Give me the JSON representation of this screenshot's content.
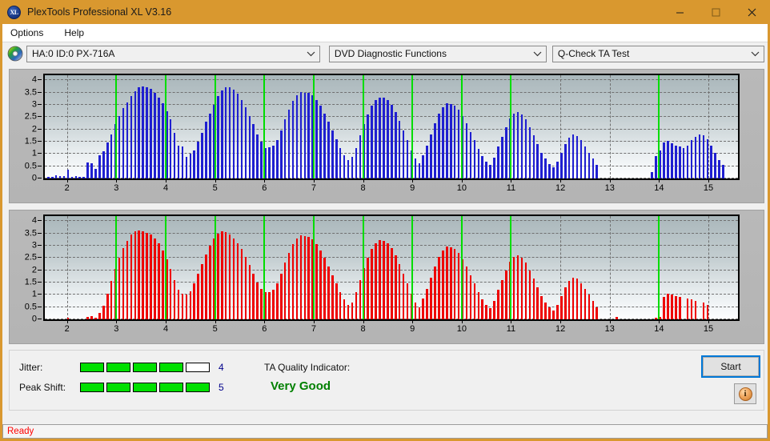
{
  "window": {
    "title": "PlexTools Professional XL V3.16",
    "icon": "XL",
    "controls": {
      "minimize": "minimize-icon",
      "maximize": "maximize-icon",
      "close": "close-icon"
    }
  },
  "menu": {
    "items": [
      "Options",
      "Help"
    ]
  },
  "toolbar": {
    "drive_icon": "disc-icon",
    "drive_select": {
      "value": "HA:0 ID:0  PX-716A"
    },
    "function_select": {
      "value": "DVD Diagnostic Functions"
    },
    "test_select": {
      "value": "Q-Check TA Test"
    }
  },
  "status": {
    "text": "Ready"
  },
  "results": {
    "jitter_label": "Jitter:",
    "jitter_value": "4",
    "jitter_filled": 4,
    "jitter_total": 5,
    "peak_shift_label": "Peak Shift:",
    "peak_shift_value": "5",
    "peak_shift_filled": 5,
    "peak_shift_total": 5,
    "tqi_label": "TA Quality Indicator:",
    "tqi_value": "Very Good",
    "tqi_color": "#008000",
    "start_button": "Start",
    "info_button": "i"
  },
  "chart_data": [
    {
      "id": "ta-test-jitter-chart",
      "type": "bar",
      "title": "",
      "xlabel": "",
      "ylabel": "",
      "series_color": "#1f1fd0",
      "marker_color": "#00dd00",
      "grid": true,
      "xlim": [
        1.55,
        15.6
      ],
      "ylim": [
        0,
        4.2
      ],
      "xticks": [
        2,
        3,
        4,
        5,
        6,
        7,
        8,
        9,
        10,
        11,
        12,
        13,
        14,
        15
      ],
      "yticks": [
        0,
        0.5,
        1,
        1.5,
        2,
        2.5,
        3,
        3.5,
        4
      ],
      "ytick_labels": [
        "0",
        "0.5",
        "1",
        "1.5",
        "2",
        "2.5",
        "3",
        "3.5",
        "4"
      ],
      "markers_x": [
        3,
        4,
        5,
        6,
        7,
        8,
        9,
        10,
        11,
        14
      ],
      "x": [
        1.62,
        1.7,
        1.78,
        1.86,
        1.94,
        2.02,
        2.1,
        2.18,
        2.26,
        2.34,
        2.42,
        2.5,
        2.58,
        2.66,
        2.74,
        2.82,
        2.9,
        2.98,
        3.06,
        3.14,
        3.22,
        3.3,
        3.38,
        3.46,
        3.54,
        3.62,
        3.7,
        3.78,
        3.86,
        3.94,
        4.02,
        4.1,
        4.18,
        4.26,
        4.34,
        4.42,
        4.5,
        4.58,
        4.66,
        4.74,
        4.82,
        4.9,
        4.98,
        5.06,
        5.14,
        5.22,
        5.3,
        5.38,
        5.46,
        5.54,
        5.62,
        5.7,
        5.78,
        5.86,
        5.94,
        6.02,
        6.1,
        6.18,
        6.26,
        6.34,
        6.42,
        6.5,
        6.58,
        6.66,
        6.74,
        6.82,
        6.9,
        6.98,
        7.06,
        7.14,
        7.22,
        7.3,
        7.38,
        7.46,
        7.54,
        7.62,
        7.7,
        7.78,
        7.86,
        7.94,
        8.02,
        8.1,
        8.18,
        8.26,
        8.34,
        8.42,
        8.5,
        8.58,
        8.66,
        8.74,
        8.82,
        8.9,
        8.98,
        9.06,
        9.14,
        9.22,
        9.3,
        9.38,
        9.46,
        9.54,
        9.62,
        9.7,
        9.78,
        9.86,
        9.94,
        10.02,
        10.1,
        10.18,
        10.26,
        10.34,
        10.42,
        10.5,
        10.58,
        10.66,
        10.74,
        10.82,
        10.9,
        10.98,
        11.06,
        11.14,
        11.22,
        11.3,
        11.38,
        11.46,
        11.54,
        11.62,
        11.7,
        11.78,
        11.86,
        11.94,
        12.02,
        12.1,
        12.18,
        12.26,
        12.34,
        12.42,
        12.5,
        12.58,
        12.66,
        12.74,
        12.82,
        12.9,
        12.98,
        13.06,
        13.14,
        13.22,
        13.3,
        13.38,
        13.46,
        13.54,
        13.62,
        13.7,
        13.78,
        13.86,
        13.94,
        14.02,
        14.1,
        14.18,
        14.26,
        14.34,
        14.42,
        14.5,
        14.58,
        14.66,
        14.74,
        14.82,
        14.9,
        14.98,
        15.06,
        15.14,
        15.22,
        15.3,
        15.38
      ],
      "values": [
        0.08,
        0.05,
        0.12,
        0.1,
        0.09,
        0.35,
        0.08,
        0.1,
        0.07,
        0.05,
        0.65,
        0.62,
        0.4,
        0.95,
        1.1,
        1.45,
        1.8,
        2.2,
        2.55,
        2.85,
        3.1,
        3.35,
        3.55,
        3.7,
        3.75,
        3.72,
        3.65,
        3.5,
        3.3,
        3.05,
        2.75,
        2.4,
        1.85,
        1.35,
        1.3,
        0.88,
        1.02,
        1.15,
        1.5,
        1.85,
        2.3,
        2.65,
        3.0,
        3.35,
        3.58,
        3.72,
        3.7,
        3.6,
        3.45,
        3.2,
        2.9,
        2.55,
        2.2,
        1.8,
        1.5,
        1.25,
        1.28,
        1.35,
        1.55,
        1.95,
        2.4,
        2.8,
        3.15,
        3.4,
        3.52,
        3.5,
        3.48,
        3.4,
        3.2,
        2.95,
        2.65,
        2.3,
        1.95,
        1.6,
        1.25,
        0.95,
        0.75,
        0.88,
        1.25,
        1.75,
        2.2,
        2.6,
        2.95,
        3.2,
        3.3,
        3.28,
        3.2,
        3.0,
        2.7,
        2.35,
        1.95,
        1.55,
        1.15,
        0.82,
        0.62,
        0.95,
        1.35,
        1.8,
        2.25,
        2.65,
        2.9,
        3.05,
        3.02,
        2.95,
        2.8,
        2.55,
        2.25,
        1.9,
        1.55,
        1.2,
        0.9,
        0.7,
        0.55,
        0.85,
        1.3,
        1.7,
        2.1,
        2.45,
        2.65,
        2.7,
        2.6,
        2.4,
        2.1,
        1.75,
        1.4,
        1.05,
        0.8,
        0.6,
        0.45,
        0.7,
        1.05,
        1.4,
        1.65,
        1.78,
        1.72,
        1.55,
        1.3,
        1.05,
        0.8,
        0.55,
        0.0,
        0.0,
        0.0,
        0.0,
        0.0,
        0.0,
        0.0,
        0.0,
        0.0,
        0.0,
        0.0,
        0.0,
        0.0,
        0.25,
        0.9,
        1.15,
        1.45,
        1.52,
        1.42,
        1.35,
        1.3,
        1.25,
        1.35,
        1.55,
        1.7,
        1.8,
        1.75,
        1.6,
        1.35,
        1.05,
        0.75,
        0.55,
        0.0,
        0.0,
        0.0,
        0.0,
        0.0,
        0.0
      ]
    },
    {
      "id": "ta-test-peak-shift-chart",
      "type": "bar",
      "title": "",
      "xlabel": "",
      "ylabel": "",
      "series_color": "#ee0000",
      "marker_color": "#00dd00",
      "grid": true,
      "xlim": [
        1.55,
        15.6
      ],
      "ylim": [
        0,
        4.2
      ],
      "xticks": [
        2,
        3,
        4,
        5,
        6,
        7,
        8,
        9,
        10,
        11,
        12,
        13,
        14,
        15
      ],
      "yticks": [
        0,
        0.5,
        1,
        1.5,
        2,
        2.5,
        3,
        3.5,
        4
      ],
      "ytick_labels": [
        "0",
        "0.5",
        "1",
        "1.5",
        "2",
        "2.5",
        "3",
        "3.5",
        "4"
      ],
      "markers_x": [
        3,
        4,
        5,
        6,
        7,
        8,
        9,
        10,
        11,
        14
      ],
      "x": [
        1.62,
        1.7,
        1.78,
        1.86,
        1.94,
        2.02,
        2.1,
        2.18,
        2.26,
        2.34,
        2.42,
        2.5,
        2.58,
        2.66,
        2.74,
        2.82,
        2.9,
        2.98,
        3.06,
        3.14,
        3.22,
        3.3,
        3.38,
        3.46,
        3.54,
        3.62,
        3.7,
        3.78,
        3.86,
        3.94,
        4.02,
        4.1,
        4.18,
        4.26,
        4.34,
        4.42,
        4.5,
        4.58,
        4.66,
        4.74,
        4.82,
        4.9,
        4.98,
        5.06,
        5.14,
        5.22,
        5.3,
        5.38,
        5.46,
        5.54,
        5.62,
        5.7,
        5.78,
        5.86,
        5.94,
        6.02,
        6.1,
        6.18,
        6.26,
        6.34,
        6.42,
        6.5,
        6.58,
        6.66,
        6.74,
        6.82,
        6.9,
        6.98,
        7.06,
        7.14,
        7.22,
        7.3,
        7.38,
        7.46,
        7.54,
        7.62,
        7.7,
        7.78,
        7.86,
        7.94,
        8.02,
        8.1,
        8.18,
        8.26,
        8.34,
        8.42,
        8.5,
        8.58,
        8.66,
        8.74,
        8.82,
        8.9,
        8.98,
        9.06,
        9.14,
        9.22,
        9.3,
        9.38,
        9.46,
        9.54,
        9.62,
        9.7,
        9.78,
        9.86,
        9.94,
        10.02,
        10.1,
        10.18,
        10.26,
        10.34,
        10.42,
        10.5,
        10.58,
        10.66,
        10.74,
        10.82,
        10.9,
        10.98,
        11.06,
        11.14,
        11.22,
        11.3,
        11.38,
        11.46,
        11.54,
        11.62,
        11.7,
        11.78,
        11.86,
        11.94,
        12.02,
        12.1,
        12.18,
        12.26,
        12.34,
        12.42,
        12.5,
        12.58,
        12.66,
        12.74,
        12.82,
        12.9,
        12.98,
        13.06,
        13.14,
        13.22,
        13.3,
        13.38,
        13.46,
        13.54,
        13.62,
        13.7,
        13.78,
        13.86,
        13.94,
        14.02,
        14.1,
        14.18,
        14.26,
        14.34,
        14.42,
        14.5,
        14.58,
        14.66,
        14.74,
        14.82,
        14.9,
        14.98,
        15.06,
        15.14,
        15.22,
        15.3,
        15.38
      ],
      "values": [
        0.0,
        0.0,
        0.0,
        0.0,
        0.0,
        0.05,
        0.0,
        0.0,
        0.0,
        0.0,
        0.1,
        0.12,
        0.08,
        0.25,
        0.55,
        1.05,
        1.55,
        2.05,
        2.5,
        2.9,
        3.2,
        3.45,
        3.58,
        3.62,
        3.58,
        3.52,
        3.45,
        3.3,
        3.08,
        2.8,
        2.45,
        2.05,
        1.6,
        1.2,
        1.05,
        1.0,
        1.15,
        1.45,
        1.85,
        2.25,
        2.65,
        3.0,
        3.3,
        3.5,
        3.58,
        3.55,
        3.45,
        3.3,
        3.1,
        2.85,
        2.55,
        2.2,
        1.85,
        1.5,
        1.25,
        1.1,
        1.1,
        1.2,
        1.45,
        1.85,
        2.3,
        2.7,
        3.05,
        3.3,
        3.42,
        3.4,
        3.35,
        3.25,
        3.05,
        2.8,
        2.5,
        2.15,
        1.8,
        1.45,
        1.1,
        0.8,
        0.6,
        0.7,
        1.1,
        1.6,
        2.1,
        2.5,
        2.85,
        3.1,
        3.22,
        3.2,
        3.1,
        2.9,
        2.6,
        2.25,
        1.85,
        1.45,
        1.05,
        0.7,
        0.5,
        0.85,
        1.25,
        1.7,
        2.15,
        2.55,
        2.8,
        2.95,
        2.92,
        2.85,
        2.7,
        2.45,
        2.15,
        1.8,
        1.45,
        1.1,
        0.8,
        0.6,
        0.45,
        0.75,
        1.2,
        1.6,
        2.0,
        2.35,
        2.55,
        2.6,
        2.5,
        2.3,
        2.0,
        1.65,
        1.3,
        0.95,
        0.7,
        0.5,
        0.35,
        0.6,
        0.95,
        1.3,
        1.55,
        1.7,
        1.65,
        1.48,
        1.25,
        1.0,
        0.75,
        0.5,
        0.0,
        0.0,
        0.0,
        0.0,
        0.1,
        0.0,
        0.0,
        0.0,
        0.0,
        0.0,
        0.0,
        0.0,
        0.0,
        0.0,
        0.05,
        0.1,
        0.9,
        1.05,
        1.0,
        0.95,
        0.92,
        0.0,
        0.85,
        0.8,
        0.75,
        0.0,
        0.7,
        0.6,
        0.0,
        0.0,
        0.0,
        0.0,
        0.0,
        0.0,
        0.0,
        0.0
      ]
    }
  ]
}
